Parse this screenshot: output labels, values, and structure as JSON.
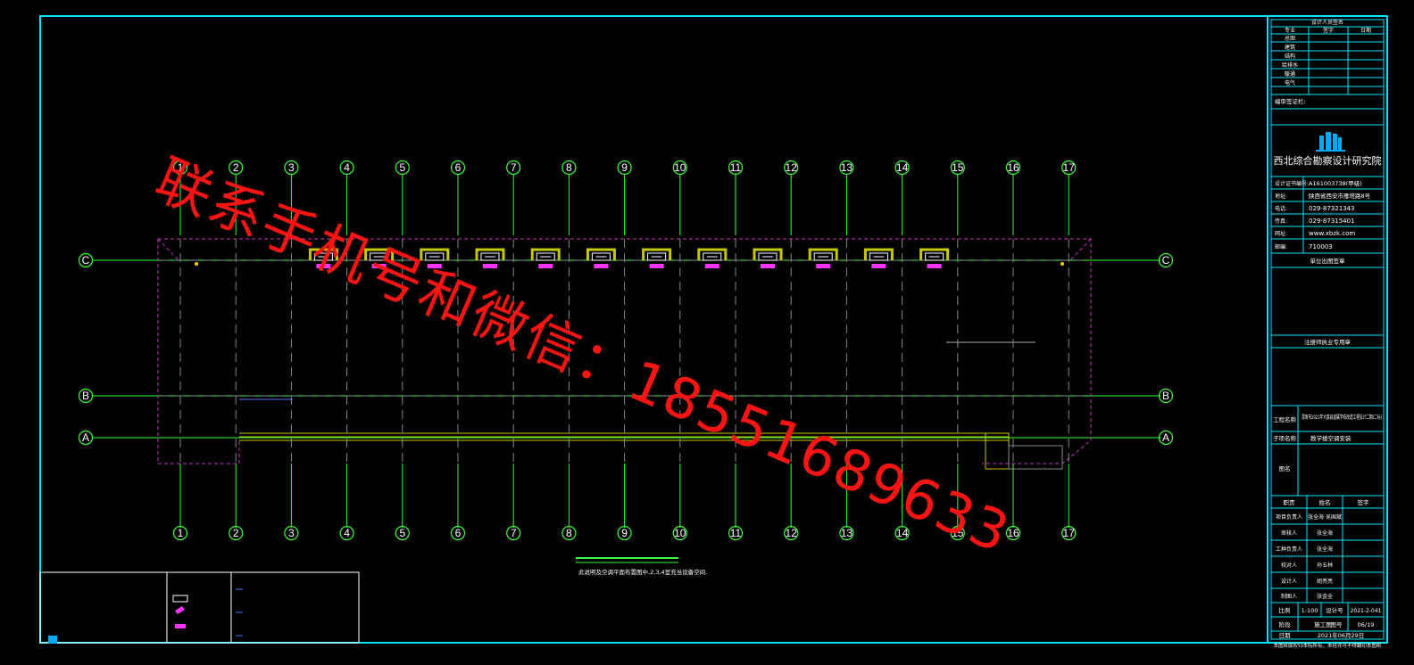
{
  "colors": {
    "background": "#000000",
    "frame": "#00e5ff",
    "axis": "#39ff39",
    "building": "#cc33cc",
    "wall": "#c8c800",
    "watermark": "#ff1414"
  },
  "watermark": "联系手机号和微信：18551689633",
  "axes": {
    "columns": [
      "1",
      "2",
      "3",
      "4",
      "5",
      "6",
      "7",
      "8",
      "9",
      "10",
      "11",
      "12",
      "13",
      "14",
      "15",
      "16",
      "17"
    ],
    "rows": [
      "C",
      "B",
      "A"
    ]
  },
  "plan_note": "此说明及空调平面布置图中,2,3,4室充当设备空间.",
  "title_block": {
    "signature_header": "设计人员签名",
    "sig_cols": [
      "专业",
      "签字",
      "日期"
    ],
    "disciplines": [
      "总图",
      "建筑",
      "结构",
      "给排水",
      "暖通",
      "电气"
    ],
    "cert_note": "编审签证栏:",
    "institute_name": "西北综合勘察设计研究院",
    "info": [
      {
        "k": "设计证书编号:",
        "v": "A161003738(甲级)"
      },
      {
        "k": "地址:",
        "v": "陕西省西安市雁塔路8号"
      },
      {
        "k": "电话:",
        "v": "029-87321343"
      },
      {
        "k": "传真:",
        "v": "029-87315401"
      },
      {
        "k": "网址:",
        "v": "www.xbzk.com"
      },
      {
        "k": "邮编:",
        "v": "710003"
      }
    ],
    "review_section": "单位出图签章",
    "reg_section": "注册师执业专用章",
    "project_label": "工程名称",
    "project_name": "渭南市2021年大荔县直属学校改造工程设计二期(二标)",
    "item_label": "子项名称",
    "item_name": "教学楼空调安装",
    "drawing_label": "图名",
    "drawing_name": "",
    "staff_header": [
      "职责",
      "姓名",
      "签字"
    ],
    "staff": [
      {
        "role": "项目负责人",
        "name": "张全海 吴国斌"
      },
      {
        "role": "审核人",
        "name": "张全海"
      },
      {
        "role": "工种负责人",
        "name": "张全海"
      },
      {
        "role": "校对人",
        "name": "孙五林"
      },
      {
        "role": "设计人",
        "name": "胡亮亮"
      },
      {
        "role": "制图人",
        "name": "张金全"
      }
    ],
    "scale_label": "比例",
    "scale": "1:100",
    "design_no_label": "设计号",
    "design_no": "2021-2-041",
    "stage_label": "阶段",
    "stage": "施工图",
    "sheet_label": "图号",
    "sheet": "06/19",
    "date_label": "日期",
    "date": "2021年06月29日",
    "footer": "本图纸版权归本院所有，未经许可不得翻印本图纸"
  }
}
